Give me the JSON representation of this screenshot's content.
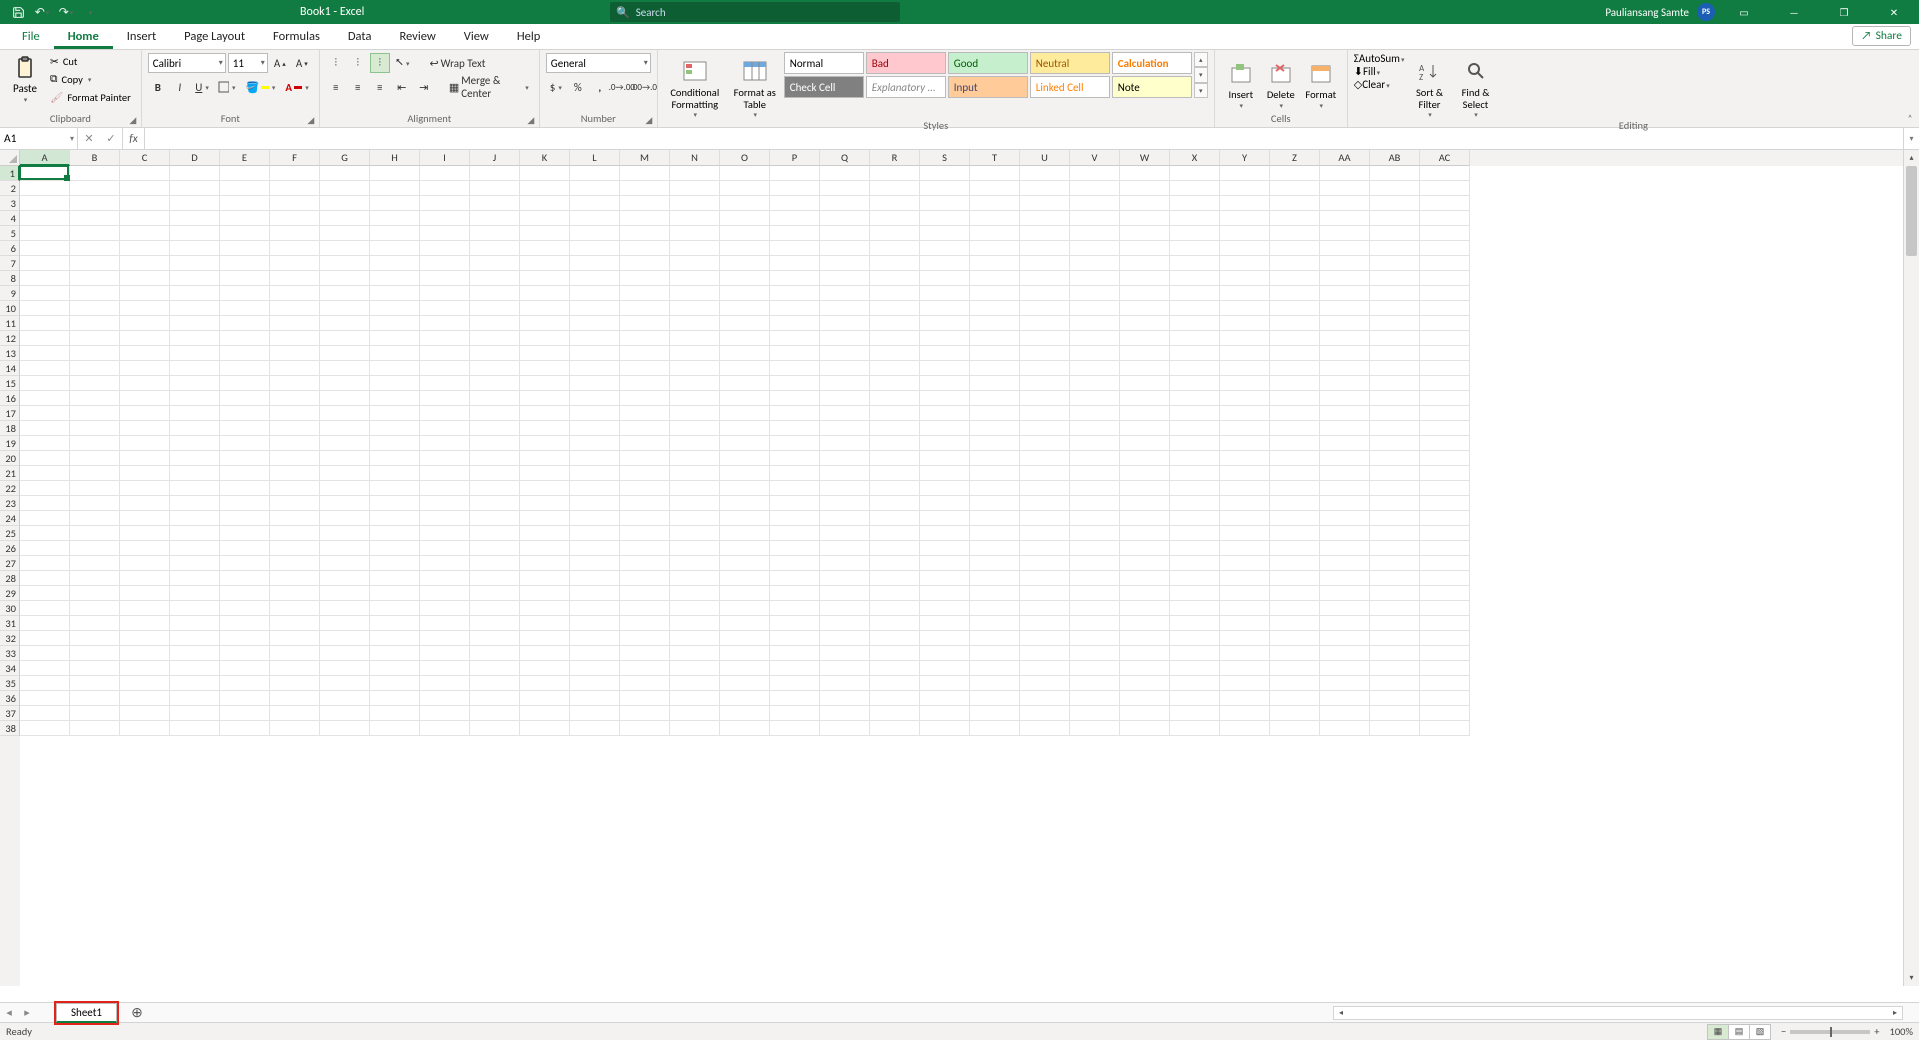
{
  "title_bar": {
    "doc_title": "Book1  -  Excel",
    "search_placeholder": "Search",
    "user_name": "Pauliansang Samte",
    "user_initials": "PS"
  },
  "tabs": {
    "file": "File",
    "home": "Home",
    "insert": "Insert",
    "page_layout": "Page Layout",
    "formulas": "Formulas",
    "data": "Data",
    "review": "Review",
    "view": "View",
    "help": "Help",
    "share": "Share"
  },
  "ribbon": {
    "clipboard": {
      "label": "Clipboard",
      "paste": "Paste",
      "cut": "Cut",
      "copy": "Copy",
      "format_painter": "Format Painter"
    },
    "font": {
      "label": "Font",
      "name": "Calibri",
      "size": "11"
    },
    "alignment": {
      "label": "Alignment",
      "wrap": "Wrap Text",
      "merge": "Merge & Center"
    },
    "number": {
      "label": "Number",
      "format": "General"
    },
    "styles": {
      "label": "Styles",
      "cond_fmt": "Conditional Formatting",
      "fmt_table": "Format as Table",
      "chips": {
        "normal": "Normal",
        "bad": "Bad",
        "good": "Good",
        "neutral": "Neutral",
        "calculation": "Calculation",
        "check_cell": "Check Cell",
        "explanatory": "Explanatory ...",
        "input": "Input",
        "linked_cell": "Linked Cell",
        "note": "Note"
      }
    },
    "cells": {
      "label": "Cells",
      "insert": "Insert",
      "delete": "Delete",
      "format": "Format"
    },
    "editing": {
      "label": "Editing",
      "autosum": "AutoSum",
      "fill": "Fill",
      "clear": "Clear",
      "sort_filter": "Sort & Filter",
      "find_select": "Find & Select"
    }
  },
  "namebox": {
    "value": "A1"
  },
  "columns": [
    "A",
    "B",
    "C",
    "D",
    "E",
    "F",
    "G",
    "H",
    "I",
    "J",
    "K",
    "L",
    "M",
    "N",
    "O",
    "P",
    "Q",
    "R",
    "S",
    "T",
    "U",
    "V",
    "W",
    "X",
    "Y",
    "Z",
    "AA",
    "AB",
    "AC"
  ],
  "row_count": 38,
  "selected_row": 1,
  "selected_col": "A",
  "sheet_tabs": {
    "sheet1": "Sheet1"
  },
  "status": {
    "ready": "Ready",
    "zoom": "100%"
  }
}
